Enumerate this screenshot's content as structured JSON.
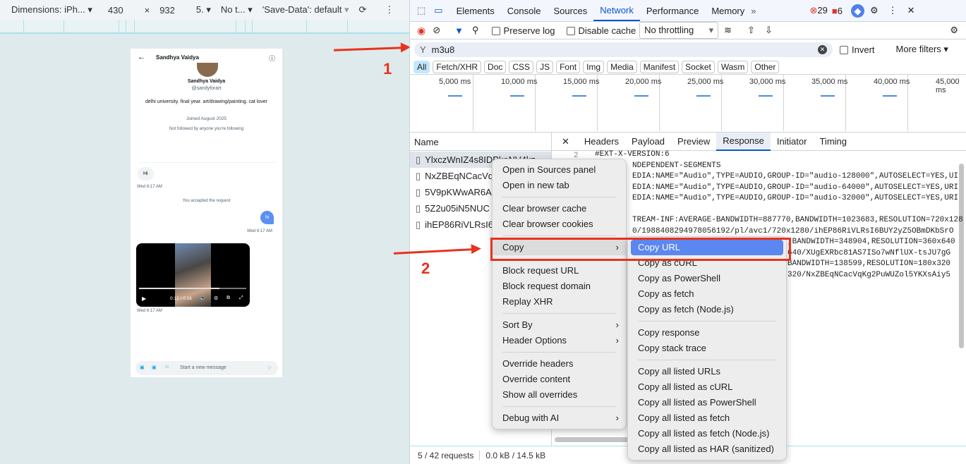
{
  "device_toolbar": {
    "dimensions": "Dimensions: iPh...",
    "width": "430",
    "x": "×",
    "height": "932",
    "dpr": "5.",
    "throttle": "No t...",
    "save_data": "'Save-Data': default"
  },
  "phone": {
    "header_name": "Sandhya Vaidya",
    "profile_name": "Sandhya Vaidya",
    "handle": "@sandyforart",
    "bio": "delhi university. final year. art/drawing/painting. cat lover",
    "joined": "Joined August 2025",
    "followed": "Not followed by anyone you're following",
    "msg_hi": "Hi",
    "time1": "Wed 6:17 AM",
    "accepted": "You accepted the request",
    "msg_hi2": "hi",
    "time2": "Wed 6:17 AM",
    "video_time": "0:12 / 0:16",
    "time3": "Wed 6:17 AM",
    "compose_placeholder": "Start a new message"
  },
  "devtools": {
    "tabs": [
      "Elements",
      "Console",
      "Sources",
      "Network",
      "Performance",
      "Memory"
    ],
    "errors": "29",
    "warnings": "6",
    "preserve_log": "Preserve log",
    "disable_cache": "Disable cache",
    "throttling": "No throttling",
    "filter_value": "m3u8",
    "invert": "Invert",
    "more_filters": "More filters",
    "types": [
      "All",
      "Fetch/XHR",
      "Doc",
      "CSS",
      "JS",
      "Font",
      "Img",
      "Media",
      "Manifest",
      "Socket",
      "Wasm",
      "Other"
    ],
    "timeline": [
      "5,000 ms",
      "10,000 ms",
      "15,000 ms",
      "20,000 ms",
      "25,000 ms",
      "30,000 ms",
      "35,000 ms",
      "40,000 ms",
      "45,000 ms"
    ],
    "name_header": "Name",
    "requests": [
      "YlxczWnIZ4s8IDPkeNV4kz",
      "NxZBEqNCacVql",
      "5V9pKWwAR6A-",
      "5Z2u05iN5NUC",
      "ihEP86RiVLRsI6l"
    ],
    "detail_tabs": [
      "Headers",
      "Payload",
      "Preview",
      "Response",
      "Initiator",
      "Timing"
    ],
    "line_number": "2",
    "response_lines": [
      "#EXT-X-VERSION:6",
      "NDEPENDENT-SEGMENTS",
      "EDIA:NAME=\"Audio\",TYPE=AUDIO,GROUP-ID=\"audio-128000\",AUTOSELECT=YES,UI",
      "EDIA:NAME=\"Audio\",TYPE=AUDIO,GROUP-ID=\"audio-64000\",AUTOSELECT=YES,URI",
      "EDIA:NAME=\"Audio\",TYPE=AUDIO,GROUP-ID=\"audio-32000\",AUTOSELECT=YES,URI",
      "TREAM-INF:AVERAGE-BANDWIDTH=887770,BANDWIDTH=1023683,RESOLUTION=720x1280",
      "0/1988408294978056192/pl/avc1/720x1280/ihEP86RiVLRsI6BUY2yZ5OBmDKbSrO",
      ",BANDWIDTH=348904,RESOLUTION=360x640",
      "640/XUgEXRbc81AS7ISo7wNflUX-tsJU7gG",
      "BANDWIDTH=138599,RESOLUTION=180x320",
      "320/NxZBEqNCacVqKg2PuWUZol5YKXsAiy5"
    ],
    "status_requests": "5 / 42 requests",
    "status_size": "0.0 kB / 14.5 kB"
  },
  "context_menu": {
    "items": [
      "Open in Sources panel",
      "Open in new tab",
      "Clear browser cache",
      "Clear browser cookies",
      "Copy",
      "Block request URL",
      "Block request domain",
      "Replay XHR",
      "Sort By",
      "Header Options",
      "Override headers",
      "Override content",
      "Show all overrides",
      "Debug with AI"
    ]
  },
  "copy_submenu": {
    "items": [
      "Copy URL",
      "Copy as cURL",
      "Copy as PowerShell",
      "Copy as fetch",
      "Copy as fetch (Node.js)",
      "Copy response",
      "Copy stack trace",
      "Copy all listed URLs",
      "Copy all listed as cURL",
      "Copy all listed as PowerShell",
      "Copy all listed as fetch",
      "Copy all listed as fetch (Node.js)",
      "Copy all listed as HAR (sanitized)"
    ]
  },
  "annotations": {
    "step1": "1",
    "step2": "2",
    "color": "#e8321e"
  }
}
